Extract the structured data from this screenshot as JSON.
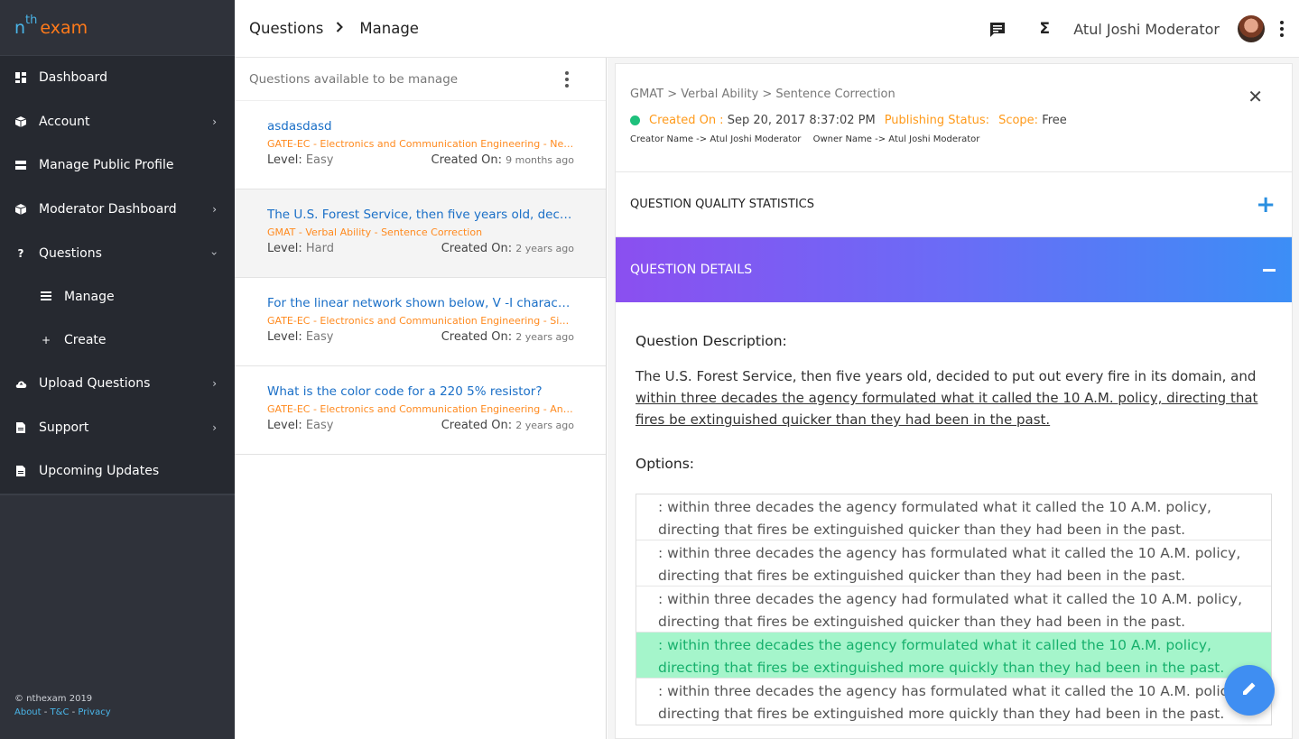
{
  "brand": {
    "n": "n",
    "th": "th",
    "exam": "exam"
  },
  "sidebar": {
    "items": [
      {
        "label": "Dashboard",
        "icon": "dashboard-icon"
      },
      {
        "label": "Account",
        "icon": "account-icon"
      },
      {
        "label": "Manage Public Profile",
        "icon": "profile-icon"
      },
      {
        "label": "Moderator Dashboard",
        "icon": "moderator-icon"
      },
      {
        "label": "Questions",
        "icon": "question-icon"
      },
      {
        "label": "Upload Questions",
        "icon": "upload-icon"
      },
      {
        "label": "Support",
        "icon": "support-icon"
      },
      {
        "label": "Upcoming Updates",
        "icon": "updates-icon"
      }
    ],
    "sub_items": [
      {
        "label": "Manage",
        "icon": "list-icon"
      },
      {
        "label": "Create",
        "icon": "plus-icon"
      }
    ],
    "footer": {
      "copyright": "© nthexam 2019",
      "about": "About",
      "tc": "T&C",
      "privacy": "Privacy",
      "sep": " - "
    }
  },
  "header": {
    "breadcrumb": [
      "Questions",
      "Manage"
    ],
    "user_name": "Atul Joshi Moderator"
  },
  "list": {
    "header": "Questions available to be manage",
    "level_label": "Level:",
    "created_label": "Created On:",
    "items": [
      {
        "title": "asdasdasd",
        "subject": "GATE-EC - Electronics and Communication Engineering - Networks",
        "level": "Easy",
        "created": "9 months ago"
      },
      {
        "title": "The U.S. Forest Service, then five years old, decided to put out every fire in its domain",
        "subject": "GMAT - Verbal Ability - Sentence Correction",
        "level": "Hard",
        "created": "2 years ago"
      },
      {
        "title": "For the linear network shown below, V -I characteristic of the network",
        "subject": "GATE-EC - Electronics and Communication Engineering - Signals and Systems",
        "level": "Easy",
        "created": "2 years ago"
      },
      {
        "title": "What is the color code for a 220  5% resistor?",
        "subject": "GATE-EC - Electronics and Communication Engineering - Analog Circuits",
        "level": "Easy",
        "created": "2 years ago"
      }
    ]
  },
  "detail": {
    "path": "GMAT > Verbal Ability > Sentence Correction",
    "created_label": "Created On :",
    "created_value": "Sep 20, 2017 8:37:02 PM",
    "publishing_label": "Publishing Status:",
    "scope_label": "Scope:",
    "scope_value": "Free",
    "creator": "Creator Name -> Atul Joshi Moderator",
    "owner": "Owner Name -> Atul Joshi Moderator",
    "stats_title": "QUESTION QUALITY STATISTICS",
    "details_title": "QUESTION DETAILS",
    "description_label": "Question Description:",
    "description_plain": "The U.S. Forest Service, then five years old, decided to put out every fire in its domain, and ",
    "description_underlined": "within three decades the agency formulated what it called the 10 A.M. policy, directing that fires be extinguished quicker than they had been in the past.",
    "options_label": "Options:",
    "options": [
      {
        "text": ": within three decades the agency formulated what it called the 10 A.M. policy, directing that fires be extinguished quicker than they had been in the past.",
        "correct": false
      },
      {
        "text": ": within three decades the agency has formulated what it called the 10 A.M. policy, directing that fires be extinguished quicker than they had been in the past.",
        "correct": false
      },
      {
        "text": ": within three decades the agency had formulated what it called the 10 A.M. policy, directing that fires be extinguished quicker than they had been in the past.",
        "correct": false
      },
      {
        "text": ": within three decades the agency formulated what it called the 10 A.M. policy, directing that fires be extinguished more quickly than they had been in the past.",
        "correct": true
      },
      {
        "text": ": within three decades the agency has formulated what it called the 10 A.M. policy, directing that fires be extinguished more quickly than they had been in the past.",
        "correct": false
      }
    ]
  },
  "colors": {
    "accent": "#3f8ef2",
    "orange": "#ff8a1f",
    "correct": "#a5f5cb",
    "sidebar": "#2f323a"
  }
}
